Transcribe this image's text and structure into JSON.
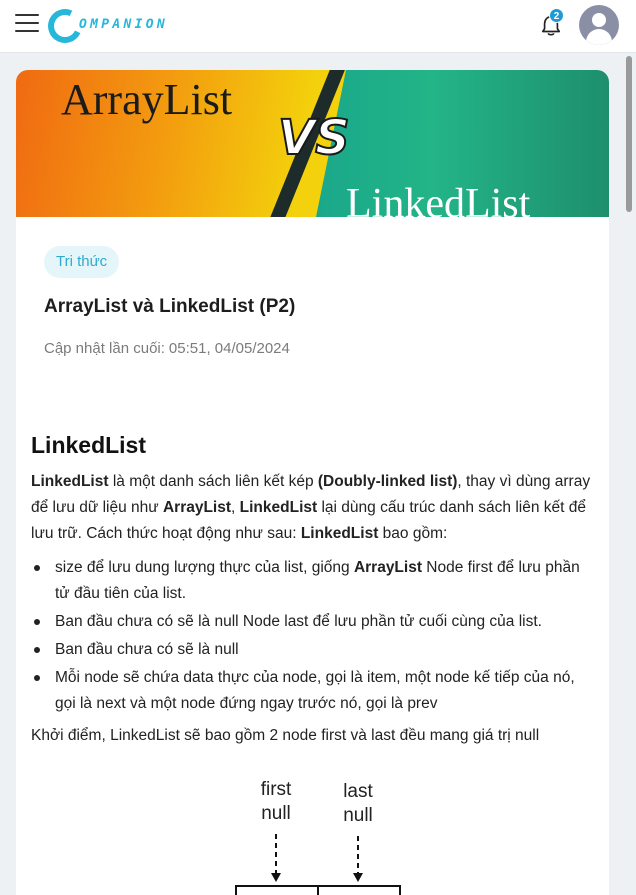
{
  "header": {
    "logo_text": "OMPANION",
    "notification_count": "2"
  },
  "banner": {
    "left_text": "ArrayList",
    "vs_text": "VS",
    "right_text": "LinkedList"
  },
  "article": {
    "tag": "Tri thức",
    "title": "ArrayList và LinkedList (P2)",
    "updated_label": "Cập nhật lần cuối:",
    "updated_value": "05:51, 04/05/2024"
  },
  "content": {
    "heading": "LinkedList",
    "intro": {
      "s1_bold": "LinkedList",
      "s1": " là một danh sách liên kết kép ",
      "s2_bold": "(Doubly-linked list)",
      "s2": ", thay vì dùng array để lưu dữ liệu như ",
      "s3_bold": "ArrayList",
      "s3": ", ",
      "s4_bold": "LinkedList",
      "s4": " lại dùng cấu trúc danh sách liên kết để lưu trữ. Cách thức hoạt động như sau: ",
      "s5_bold": "LinkedList",
      "s5": " bao gồm:"
    },
    "bullets": {
      "b1_a": "size để lưu dung lượng thực của list, giống ",
      "b1_bold": "ArrayList",
      "b1_b": " Node first để lưu phần tử đầu tiên của list.",
      "b2": "Ban đầu chưa có sẽ là null Node last để lưu phần tử cuối cùng của list.",
      "b3": "Ban đầu chưa có sẽ là null",
      "b4": "Mỗi node sẽ chứa data thực của node, gọi là item, một node kế tiếp của nó, gọi là next và một node đứng ngay trước nó, gọi là prev"
    },
    "closing": "Khởi điểm, LinkedList sẽ bao gồm 2 node first và last đều mang giá trị null"
  },
  "diagram": {
    "first_label": "first",
    "first_value": "null",
    "last_label": "last",
    "last_value": "null"
  },
  "colors": {
    "accent": "#27b7d8",
    "badge": "#1e9bd6",
    "tag_bg": "#e5f6fb",
    "tag_text": "#33a8cf"
  }
}
